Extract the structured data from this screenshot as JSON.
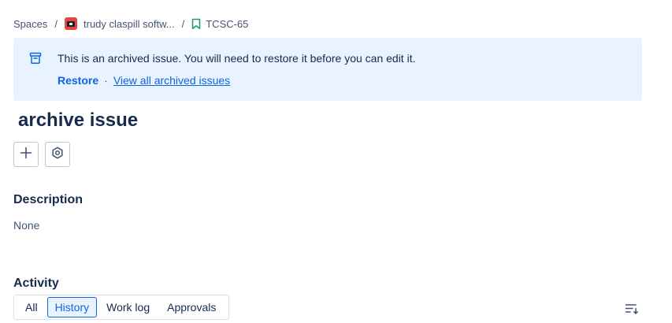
{
  "breadcrumb": {
    "root": "Spaces",
    "separator": "/",
    "space_name": "trudy claspill softw...",
    "space_icon": "space-avatar-icon",
    "issue_key": "TCSC-65",
    "issue_icon": "bookmark-icon"
  },
  "banner": {
    "icon": "archive-icon",
    "message": "This is an archived issue. You will need to restore it before you can edit it.",
    "restore_label": "Restore",
    "separator": "·",
    "view_all_label": "View all archived issues"
  },
  "issue": {
    "title": "archive issue"
  },
  "actions": {
    "add_icon": "plus-icon",
    "apps_icon": "hexagon-apps-icon"
  },
  "description": {
    "heading": "Description",
    "value": "None"
  },
  "activity": {
    "heading": "Activity",
    "tabs": [
      {
        "label": "All",
        "active": false
      },
      {
        "label": "History",
        "active": true
      },
      {
        "label": "Work log",
        "active": false
      },
      {
        "label": "Approvals",
        "active": false
      }
    ],
    "sort_icon": "sort-icon"
  },
  "colors": {
    "accent": "#0c66e4",
    "banner_bg": "#e9f2ff",
    "text": "#172b4d",
    "subtle_text": "#44546f"
  }
}
